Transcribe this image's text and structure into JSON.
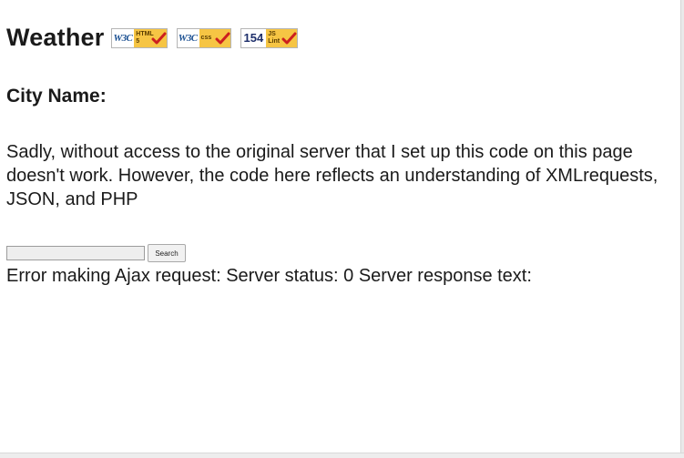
{
  "page": {
    "title": "Weather",
    "badges": [
      {
        "issuer": "W3C",
        "tag_line1": "HTML",
        "tag_line2": "5",
        "icon": "checkmark-icon"
      },
      {
        "issuer": "W3C",
        "tag_line1": "css",
        "tag_line2": "",
        "icon": "checkmark-icon"
      },
      {
        "issuer": "154",
        "tag_line1": "JS",
        "tag_line2": "Lint",
        "icon": "checkmark-icon"
      }
    ],
    "city_heading": "City Name:",
    "note": "Sadly, without access to the original server that I set up this code on this page doesn't work. However, the code here reflects an understanding of XMLrequests, JSON, and PHP",
    "search": {
      "input_value": "",
      "button_label": "Search"
    },
    "error_text": "Error making Ajax request: Server status: 0 Server response text:"
  },
  "colors": {
    "badge_tag": "#f6c544",
    "badge_check": "#cc1f1f",
    "w3c_blue": "#1a4f91"
  }
}
